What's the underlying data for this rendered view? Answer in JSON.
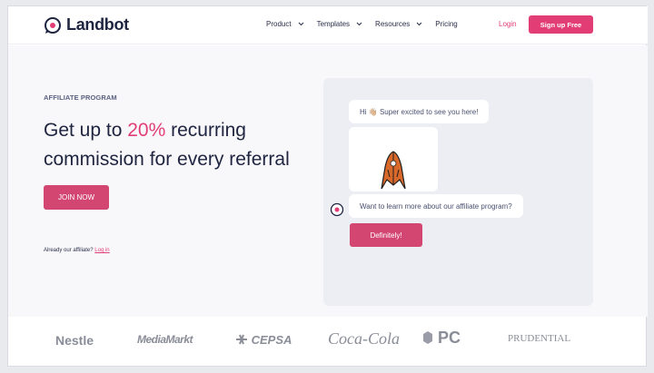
{
  "header": {
    "brand": "Landbot",
    "nav": [
      {
        "label": "Product"
      },
      {
        "label": "Templates"
      },
      {
        "label": "Resources"
      },
      {
        "label": "Pricing"
      }
    ],
    "login_label": "Login",
    "signup_label": "Sign up Free"
  },
  "hero": {
    "eyebrow": "AFFILIATE PROGRAM",
    "headline_pre": "Get up to ",
    "headline_accent": "20%",
    "headline_post": " recurring commission for every referral",
    "cta_label": "JOIN NOW",
    "already_text": "Already our affiliate?",
    "login_link": "Log in"
  },
  "chat": {
    "greeting": "Hi 👋🏼 Super excited to see you here!",
    "question": "Want to learn more about our affiliate program?",
    "reply_button": "Definitely!"
  },
  "logos": [
    "Nestle",
    "MediaMarkt",
    "CEPSA",
    "Coca-Cola",
    "PC",
    "PRUDENTIAL"
  ],
  "colors": {
    "accent": "#e23d74",
    "button": "#d34672",
    "text": "#1f2440"
  }
}
